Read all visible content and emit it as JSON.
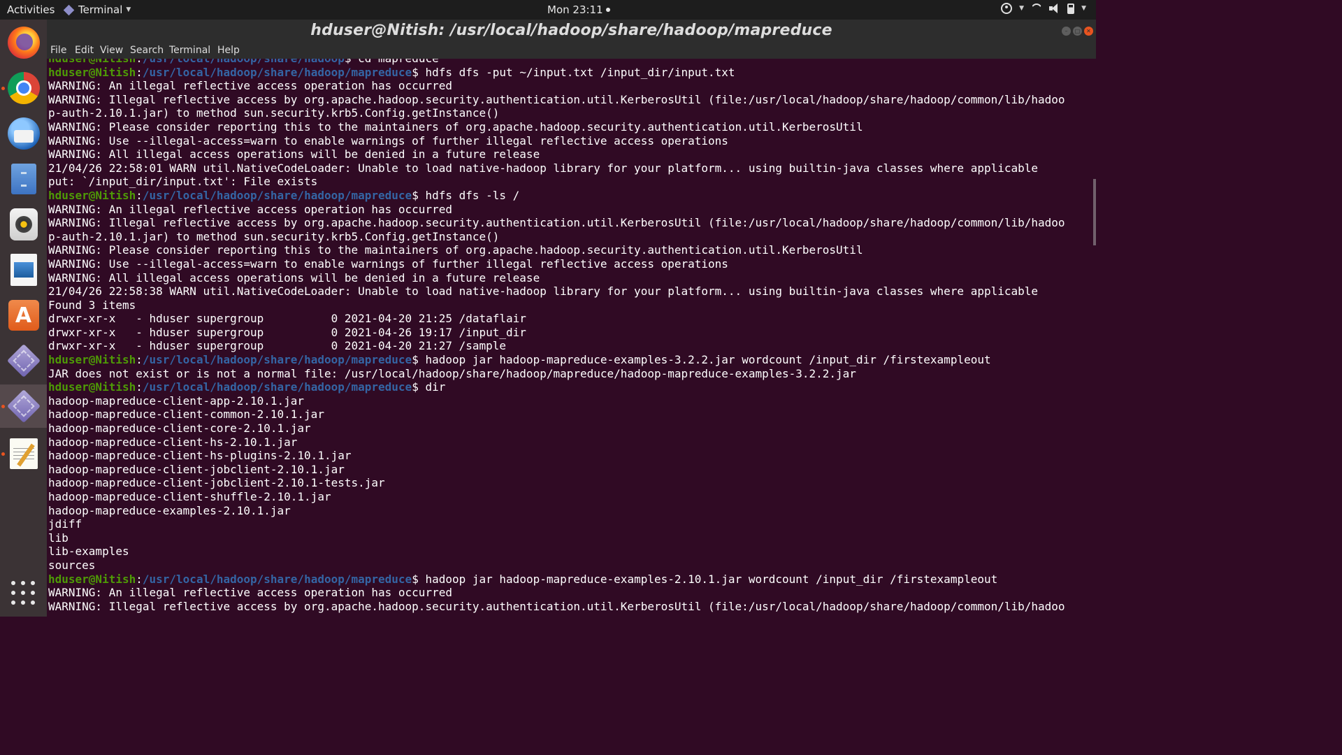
{
  "top_panel": {
    "activities": "Activities",
    "app_name": "Terminal",
    "clock": "Mon 23:11"
  },
  "dock": {
    "items": [
      {
        "icon": "firefox-icon"
      },
      {
        "icon": "chrome-icon"
      },
      {
        "icon": "thunderbird-icon"
      },
      {
        "icon": "files-icon"
      },
      {
        "icon": "rhythmbox-icon"
      },
      {
        "icon": "libreoffice-writer-icon"
      },
      {
        "icon": "ubuntu-software-icon"
      },
      {
        "icon": "app-icon"
      },
      {
        "icon": "app-icon"
      },
      {
        "icon": "text-editor-icon"
      },
      {
        "icon": "show-applications-icon"
      }
    ]
  },
  "window": {
    "title": "hduser@Nitish: /usr/local/hadoop/share/hadoop/mapreduce",
    "menu": [
      "File",
      "Edit",
      "View",
      "Search",
      "Terminal",
      "Help"
    ]
  },
  "terminal": {
    "prompt_user": "hduser@Nitish",
    "prompt_sep": ":",
    "prompt_path": "/usr/local/hadoop/share/hadoop/mapreduce",
    "prompt_path_partial": "/usr/local/hadoop/share/hadoop",
    "prompt_end": "$ ",
    "lines": [
      {
        "type": "prompt_partial",
        "cmd": "cd mapreduce"
      },
      {
        "type": "prompt",
        "cmd": "hdfs dfs -put ~/input.txt /input_dir/input.txt"
      },
      {
        "type": "out",
        "text": "WARNING: An illegal reflective access operation has occurred"
      },
      {
        "type": "out",
        "text": "WARNING: Illegal reflective access by org.apache.hadoop.security.authentication.util.KerberosUtil (file:/usr/local/hadoop/share/hadoop/common/lib/hadoo"
      },
      {
        "type": "out",
        "text": "p-auth-2.10.1.jar) to method sun.security.krb5.Config.getInstance()"
      },
      {
        "type": "out",
        "text": "WARNING: Please consider reporting this to the maintainers of org.apache.hadoop.security.authentication.util.KerberosUtil"
      },
      {
        "type": "out",
        "text": "WARNING: Use --illegal-access=warn to enable warnings of further illegal reflective access operations"
      },
      {
        "type": "out",
        "text": "WARNING: All illegal access operations will be denied in a future release"
      },
      {
        "type": "out",
        "text": "21/04/26 22:58:01 WARN util.NativeCodeLoader: Unable to load native-hadoop library for your platform... using builtin-java classes where applicable"
      },
      {
        "type": "out",
        "text": "put: `/input_dir/input.txt': File exists"
      },
      {
        "type": "prompt",
        "cmd": "hdfs dfs -ls /"
      },
      {
        "type": "out",
        "text": "WARNING: An illegal reflective access operation has occurred"
      },
      {
        "type": "out",
        "text": "WARNING: Illegal reflective access by org.apache.hadoop.security.authentication.util.KerberosUtil (file:/usr/local/hadoop/share/hadoop/common/lib/hadoo"
      },
      {
        "type": "out",
        "text": "p-auth-2.10.1.jar) to method sun.security.krb5.Config.getInstance()"
      },
      {
        "type": "out",
        "text": "WARNING: Please consider reporting this to the maintainers of org.apache.hadoop.security.authentication.util.KerberosUtil"
      },
      {
        "type": "out",
        "text": "WARNING: Use --illegal-access=warn to enable warnings of further illegal reflective access operations"
      },
      {
        "type": "out",
        "text": "WARNING: All illegal access operations will be denied in a future release"
      },
      {
        "type": "out",
        "text": "21/04/26 22:58:38 WARN util.NativeCodeLoader: Unable to load native-hadoop library for your platform... using builtin-java classes where applicable"
      },
      {
        "type": "out",
        "text": "Found 3 items"
      },
      {
        "type": "out",
        "text": "drwxr-xr-x   - hduser supergroup          0 2021-04-20 21:25 /dataflair"
      },
      {
        "type": "out",
        "text": "drwxr-xr-x   - hduser supergroup          0 2021-04-26 19:17 /input_dir"
      },
      {
        "type": "out",
        "text": "drwxr-xr-x   - hduser supergroup          0 2021-04-20 21:27 /sample"
      },
      {
        "type": "prompt",
        "cmd": "hadoop jar hadoop-mapreduce-examples-3.2.2.jar wordcount /input_dir /firstexampleout"
      },
      {
        "type": "out",
        "text": "JAR does not exist or is not a normal file: /usr/local/hadoop/share/hadoop/mapreduce/hadoop-mapreduce-examples-3.2.2.jar"
      },
      {
        "type": "prompt",
        "cmd": "dir"
      },
      {
        "type": "out",
        "text": "hadoop-mapreduce-client-app-2.10.1.jar"
      },
      {
        "type": "out",
        "text": "hadoop-mapreduce-client-common-2.10.1.jar"
      },
      {
        "type": "out",
        "text": "hadoop-mapreduce-client-core-2.10.1.jar"
      },
      {
        "type": "out",
        "text": "hadoop-mapreduce-client-hs-2.10.1.jar"
      },
      {
        "type": "out",
        "text": "hadoop-mapreduce-client-hs-plugins-2.10.1.jar"
      },
      {
        "type": "out",
        "text": "hadoop-mapreduce-client-jobclient-2.10.1.jar"
      },
      {
        "type": "out",
        "text": "hadoop-mapreduce-client-jobclient-2.10.1-tests.jar"
      },
      {
        "type": "out",
        "text": "hadoop-mapreduce-client-shuffle-2.10.1.jar"
      },
      {
        "type": "out",
        "text": "hadoop-mapreduce-examples-2.10.1.jar"
      },
      {
        "type": "out",
        "text": "jdiff"
      },
      {
        "type": "out",
        "text": "lib"
      },
      {
        "type": "out",
        "text": "lib-examples"
      },
      {
        "type": "out",
        "text": "sources"
      },
      {
        "type": "prompt",
        "cmd": "hadoop jar hadoop-mapreduce-examples-2.10.1.jar wordcount /input_dir /firstexampleout"
      },
      {
        "type": "out",
        "text": "WARNING: An illegal reflective access operation has occurred"
      },
      {
        "type": "out",
        "text": "WARNING: Illegal reflective access by org.apache.hadoop.security.authentication.util.KerberosUtil (file:/usr/local/hadoop/share/hadoop/common/lib/hadoo"
      }
    ]
  },
  "colors": {
    "terminal_bg": "#300a24",
    "prompt_user": "#4e9a06",
    "prompt_path": "#3465a4",
    "accent": "#e95420"
  }
}
